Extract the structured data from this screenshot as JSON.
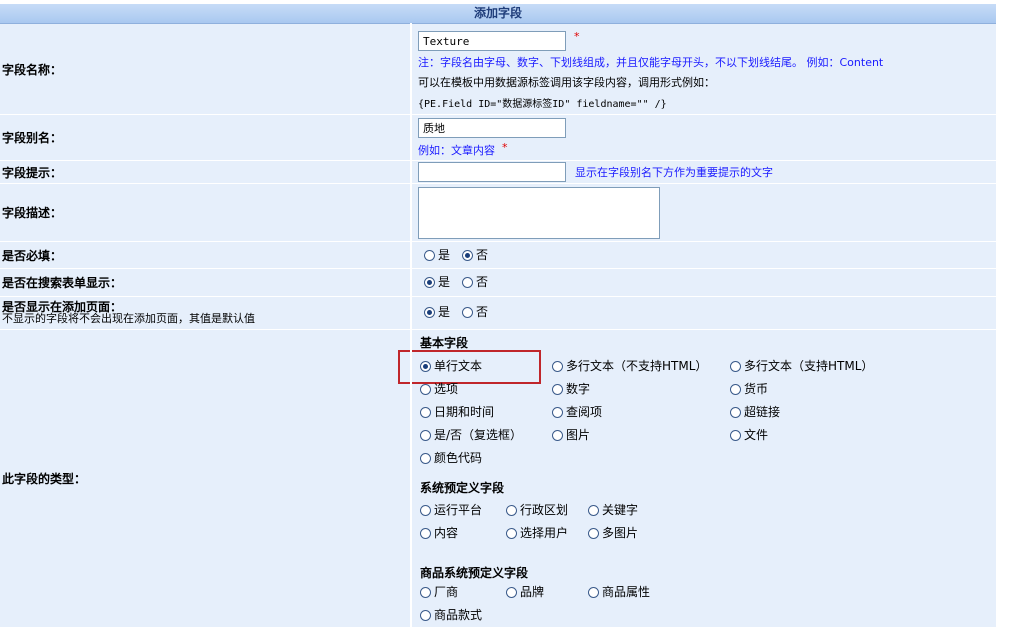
{
  "title": "添加字段",
  "fields": {
    "name": {
      "label": "字段名称：",
      "value": "Texture",
      "note1": "注：字段名由字母、数字、下划线组成，并且仅能字母开头，不以下划线结尾。 例如：Content",
      "note2": "可以在模板中用数据源标签调用该字段内容，调用形式例如：",
      "note3": "{PE.Field ID=\"数据源标签ID\" fieldname=\"\" /}"
    },
    "alias": {
      "label": "字段别名：",
      "value": "质地",
      "hint": "例如：文章内容"
    },
    "tip": {
      "label": "字段提示：",
      "value": "",
      "hint": "显示在字段别名下方作为重要提示的文字"
    },
    "desc": {
      "label": "字段描述：",
      "value": ""
    },
    "required": {
      "label": "是否必填：",
      "opt_yes": "是",
      "opt_no": "否",
      "selected": "否"
    },
    "search": {
      "label": "是否在搜索表单显示：",
      "opt_yes": "是",
      "opt_no": "否",
      "selected": "是"
    },
    "show_add": {
      "label": "是否显示在添加页面：",
      "sublabel": "不显示的字段将不会出现在添加页面，其值是默认值",
      "opt_yes": "是",
      "opt_no": "否",
      "selected": "是"
    },
    "type": {
      "label": "此字段的类型：",
      "basic_title": "基本字段",
      "basic": [
        "单行文本",
        "多行文本（不支持HTML）",
        "多行文本（支持HTML）",
        "选项",
        "数字",
        "货币",
        "日期和时间",
        "查阅项",
        "超链接",
        "是/否（复选框）",
        "图片",
        "文件",
        "颜色代码"
      ],
      "selected": "单行文本",
      "system_title": "系统预定义字段",
      "system": [
        "运行平台",
        "行政区划",
        "关键字",
        "内容",
        "选择用户",
        "多图片"
      ],
      "product_title": "商品系统预定义字段",
      "product": [
        "厂商",
        "品牌",
        "商品属性",
        "商品款式"
      ]
    }
  },
  "required_mark": "*"
}
